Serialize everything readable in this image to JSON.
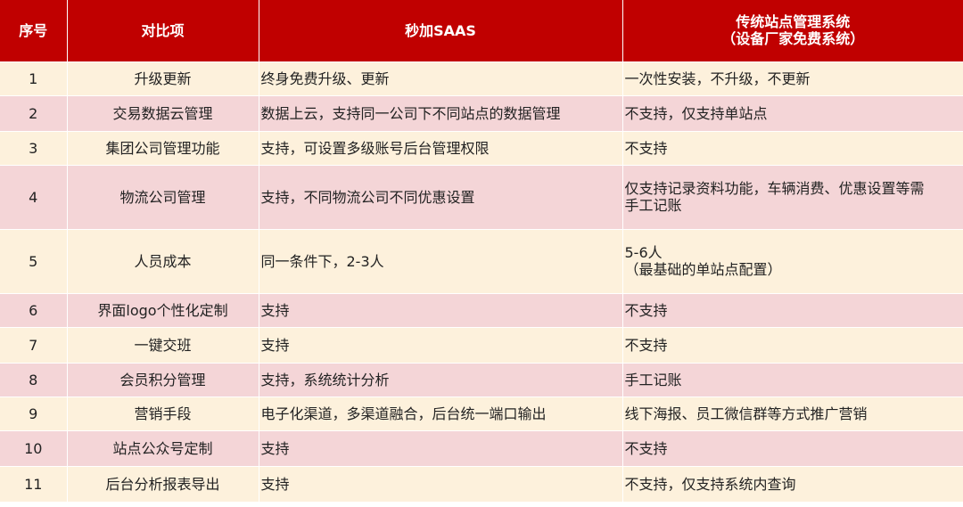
{
  "table": {
    "headers": {
      "no": "序号",
      "item": "对比项",
      "saas": "秒加SAAS",
      "trad_line1": "传统站点管理系统",
      "trad_line2": "（设备厂家免费系统）"
    },
    "rows": [
      {
        "no": "1",
        "item": "升级更新",
        "saas": "终身免费升级、更新",
        "trad": [
          "一次性安装，不升级，不更新"
        ]
      },
      {
        "no": "2",
        "item": "交易数据云管理",
        "saas": "数据上云，支持同一公司下不同站点的数据管理",
        "trad": [
          "不支持，仅支持单站点"
        ]
      },
      {
        "no": "3",
        "item": "集团公司管理功能",
        "saas": "支持，可设置多级账号后台管理权限",
        "trad": [
          "不支持"
        ]
      },
      {
        "no": "4",
        "item": "物流公司管理",
        "saas": "支持，不同物流公司不同优惠设置",
        "trad": [
          "仅支持记录资料功能，车辆消费、优惠设置等需",
          "手工记账"
        ]
      },
      {
        "no": "5",
        "item": "人员成本",
        "saas": "同一条件下，2-3人",
        "trad": [
          "5-6人",
          "（最基础的单站点配置）"
        ]
      },
      {
        "no": "6",
        "item": "界面logo个性化定制",
        "saas": "支持",
        "trad": [
          "不支持"
        ]
      },
      {
        "no": "7",
        "item": "一键交班",
        "saas": "支持",
        "trad": [
          "不支持"
        ]
      },
      {
        "no": "8",
        "item": "会员积分管理",
        "saas": "支持，系统统计分析",
        "trad": [
          "手工记账"
        ]
      },
      {
        "no": "9",
        "item": "营销手段",
        "saas": "电子化渠道，多渠道融合，后台统一端口输出",
        "trad": [
          "线下海报、员工微信群等方式推广营销"
        ]
      },
      {
        "no": "10",
        "item": "站点公众号定制",
        "saas": "支持",
        "trad": [
          "不支持"
        ]
      },
      {
        "no": "11",
        "item": "后台分析报表导出",
        "saas": "支持",
        "trad": [
          "不支持，仅支持系统内查询"
        ]
      }
    ]
  }
}
